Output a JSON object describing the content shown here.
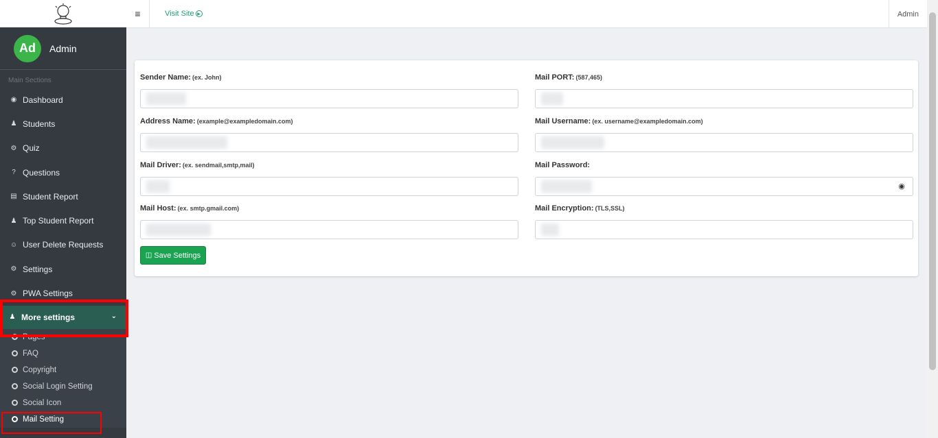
{
  "topbar": {
    "visit_site": "Visit Site",
    "admin": "Admin"
  },
  "sidebar": {
    "user_name": "Admin",
    "avatar_initials": "Ad",
    "section_header": "Main Sections",
    "items": [
      {
        "label": "Dashboard",
        "icon": "dashboard-icon"
      },
      {
        "label": "Students",
        "icon": "users-icon"
      },
      {
        "label": "Quiz",
        "icon": "cogs-icon"
      },
      {
        "label": "Questions",
        "icon": "question-icon"
      },
      {
        "label": "Student Report",
        "icon": "report-icon"
      },
      {
        "label": "Top Student Report",
        "icon": "user-icon"
      },
      {
        "label": "User Delete Requests",
        "icon": "user-circle-icon"
      },
      {
        "label": "Settings",
        "icon": "gear-icon"
      },
      {
        "label": "PWA Settings",
        "icon": "cogs-icon"
      }
    ],
    "more_settings": "More settings",
    "sub_items": [
      "Pages",
      "FAQ",
      "Copyright",
      "Social Login Setting",
      "Social Icon",
      "Mail Setting"
    ]
  },
  "form": {
    "sender_name": {
      "label": "Sender Name:",
      "hint": "(ex. John)"
    },
    "mail_port": {
      "label": "Mail PORT:",
      "hint": "(587,465)"
    },
    "address_name": {
      "label": "Address Name:",
      "hint": "(example@exampledomain.com)"
    },
    "mail_username": {
      "label": "Mail Username:",
      "hint": "(ex. username@exampledomain.com)"
    },
    "mail_driver": {
      "label": "Mail Driver:",
      "hint": "(ex. sendmail,smtp,mail)"
    },
    "mail_password": {
      "label": "Mail Password:",
      "hint": ""
    },
    "mail_host": {
      "label": "Mail Host:",
      "hint": "(ex. smtp.gmail.com)"
    },
    "mail_encryption": {
      "label": "Mail Encryption:",
      "hint": "(TLS,SSL)"
    },
    "save_label": "Save Settings"
  },
  "colors": {
    "sidebar": "#343a40",
    "accent_green": "#1aa350",
    "active_nav": "#2a5e52",
    "highlight": "#ff0000"
  }
}
